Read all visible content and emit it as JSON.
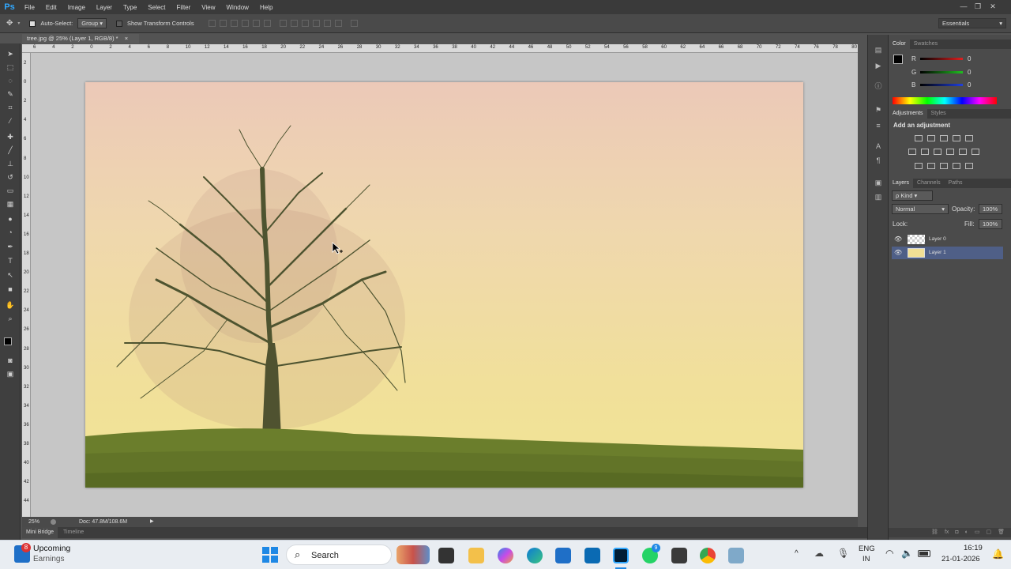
{
  "app": {
    "logo": "Ps",
    "menu": [
      "File",
      "Edit",
      "Image",
      "Layer",
      "Type",
      "Select",
      "Filter",
      "View",
      "Window",
      "Help"
    ]
  },
  "window_controls": {
    "minimize": "—",
    "restore": "❐",
    "close": "✕"
  },
  "options_bar": {
    "auto_select_label": "Auto-Select:",
    "auto_select_value": "Group",
    "transform_label": "Show Transform Controls",
    "workspace": "Essentials"
  },
  "document": {
    "tab_title": "tree.jpg @ 25% (Layer 1, RGB/8) *",
    "tab_close": "×"
  },
  "rulers": {
    "horizontal": [
      "6",
      "4",
      "2",
      "0",
      "2",
      "4",
      "6",
      "8",
      "10",
      "12",
      "14",
      "16",
      "18",
      "20",
      "22",
      "24",
      "26",
      "28",
      "30",
      "32",
      "34",
      "36",
      "38",
      "40",
      "42",
      "44",
      "46",
      "48",
      "50",
      "52",
      "54",
      "56",
      "58",
      "60",
      "62",
      "64",
      "66",
      "68",
      "70",
      "72",
      "74",
      "76",
      "78",
      "80"
    ],
    "vertical": [
      "2",
      "0",
      "2",
      "4",
      "6",
      "8",
      "10",
      "12",
      "14",
      "16",
      "18",
      "20",
      "22",
      "24",
      "26",
      "28",
      "30",
      "32",
      "34",
      "36",
      "38",
      "40",
      "42",
      "44"
    ]
  },
  "status_bar": {
    "zoom": "25%",
    "doc_info": "Doc: 47.8M/108.6M",
    "arrow": "▶"
  },
  "bottom_tabs": [
    "Mini Bridge",
    "Timeline"
  ],
  "color_panel": {
    "tabs": [
      "Color",
      "Swatches"
    ],
    "channels": [
      {
        "label": "R",
        "value": "0",
        "color": "#e02020"
      },
      {
        "label": "G",
        "value": "0",
        "color": "#20c020"
      },
      {
        "label": "B",
        "value": "0",
        "color": "#2040e0"
      }
    ]
  },
  "adjustments_panel": {
    "tabs": [
      "Adjustments",
      "Styles"
    ],
    "heading": "Add an adjustment"
  },
  "layers_panel": {
    "tabs": [
      "Layers",
      "Channels",
      "Paths"
    ],
    "filter_kind": "ρ Kind",
    "blend_mode": "Normal",
    "opacity_label": "Opacity:",
    "opacity_value": "100%",
    "lock_label": "Lock:",
    "fill_label": "Fill:",
    "fill_value": "100%",
    "layers": [
      {
        "name": "Layer 0",
        "selected": false
      },
      {
        "name": "Layer 1",
        "selected": true
      }
    ]
  },
  "taskbar": {
    "widget_badge": "8",
    "widget_title": "Upcoming",
    "widget_subtitle": "Earnings",
    "search_label": "Search",
    "whatsapp_badge": "9",
    "lang_top": "ENG",
    "lang_bottom": "IN",
    "time": "16:19",
    "date": "21-01-2026",
    "tray_chevron": "^"
  },
  "colors": {
    "accent": "#31a8ff",
    "selected_layer": "#4f5f87",
    "taskbar": "#e9edf2"
  }
}
